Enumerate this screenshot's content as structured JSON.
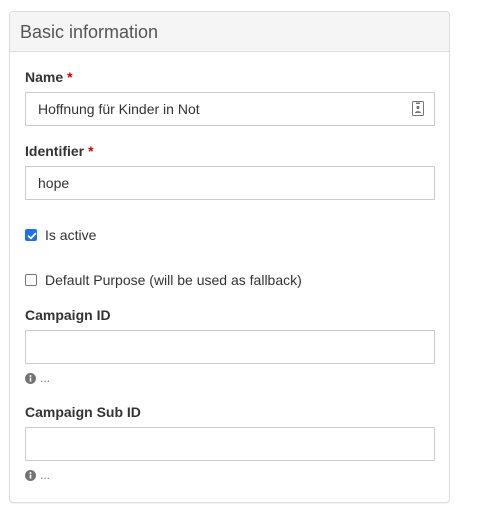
{
  "panel": {
    "title": "Basic information"
  },
  "fields": {
    "name": {
      "label": "Name",
      "required_mark": "*",
      "value": "Hoffnung für Kinder in Not",
      "icon": "contact-card-icon"
    },
    "identifier": {
      "label": "Identifier",
      "required_mark": "*",
      "value": "hope"
    },
    "is_active": {
      "label": "Is active",
      "checked": true
    },
    "default_purpose": {
      "label": "Default Purpose (will be used as fallback)",
      "checked": false
    },
    "campaign_id": {
      "label": "Campaign ID",
      "value": "",
      "help": "..."
    },
    "campaign_sub_id": {
      "label": "Campaign Sub ID",
      "value": "",
      "help": "..."
    }
  },
  "colors": {
    "accent": "#1a73e8",
    "required": "#cc0000",
    "heading_bg": "#f5f5f5",
    "border": "#dddddd"
  }
}
